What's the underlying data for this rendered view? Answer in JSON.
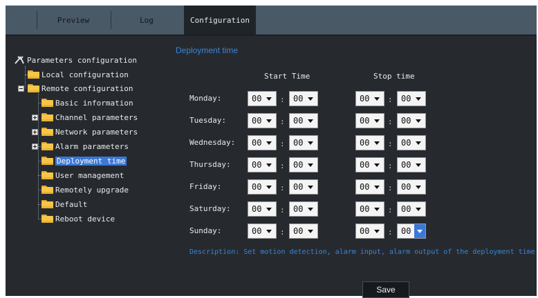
{
  "tabs": [
    {
      "label": "Preview"
    },
    {
      "label": "Log"
    },
    {
      "label": "Configuration",
      "active": true
    }
  ],
  "sidebar": {
    "root": {
      "label": "Parameters configuration",
      "icon": "tools-icon"
    },
    "items": [
      {
        "label": "Local configuration",
        "level": 1,
        "expander": "none"
      },
      {
        "label": "Remote configuration",
        "level": 1,
        "expander": "minus"
      },
      {
        "label": "Basic information",
        "level": 2,
        "expander": "none"
      },
      {
        "label": "Channel parameters",
        "level": 2,
        "expander": "plus"
      },
      {
        "label": "Network parameters",
        "level": 2,
        "expander": "plus"
      },
      {
        "label": "Alarm parameters",
        "level": 2,
        "expander": "plus"
      },
      {
        "label": "Deployment time",
        "level": 2,
        "expander": "none",
        "selected": true
      },
      {
        "label": "User management",
        "level": 2,
        "expander": "none"
      },
      {
        "label": "Remotely upgrade",
        "level": 2,
        "expander": "none"
      },
      {
        "label": "Default",
        "level": 2,
        "expander": "none"
      },
      {
        "label": "Reboot device",
        "level": 2,
        "expander": "none"
      }
    ]
  },
  "main": {
    "title": "Deployment time",
    "start_time_label": "Start Time",
    "stop_time_label": "Stop time",
    "separator": ":",
    "days": [
      {
        "label": "Monday:",
        "start_h": "00",
        "start_m": "00",
        "stop_h": "00",
        "stop_m": "00"
      },
      {
        "label": "Tuesday:",
        "start_h": "00",
        "start_m": "00",
        "stop_h": "00",
        "stop_m": "00"
      },
      {
        "label": "Wednesday:",
        "start_h": "00",
        "start_m": "00",
        "stop_h": "00",
        "stop_m": "00"
      },
      {
        "label": "Thursday:",
        "start_h": "00",
        "start_m": "00",
        "stop_h": "00",
        "stop_m": "00"
      },
      {
        "label": "Friday:",
        "start_h": "00",
        "start_m": "00",
        "stop_h": "00",
        "stop_m": "00"
      },
      {
        "label": "Saturday:",
        "start_h": "00",
        "start_m": "00",
        "stop_h": "00",
        "stop_m": "00"
      },
      {
        "label": "Sunday:",
        "start_h": "00",
        "start_m": "00",
        "stop_h": "00",
        "stop_m": "00",
        "focused": "stop_m"
      }
    ],
    "description": "Description: Set motion detection, alarm input, alarm output of the deployment time",
    "save_label": "Save"
  },
  "colors": {
    "background": "#262a2f",
    "topbar": "#4a5966",
    "accent": "#3a86d6",
    "selection": "#3b78d8",
    "folder": "#f7c648"
  }
}
